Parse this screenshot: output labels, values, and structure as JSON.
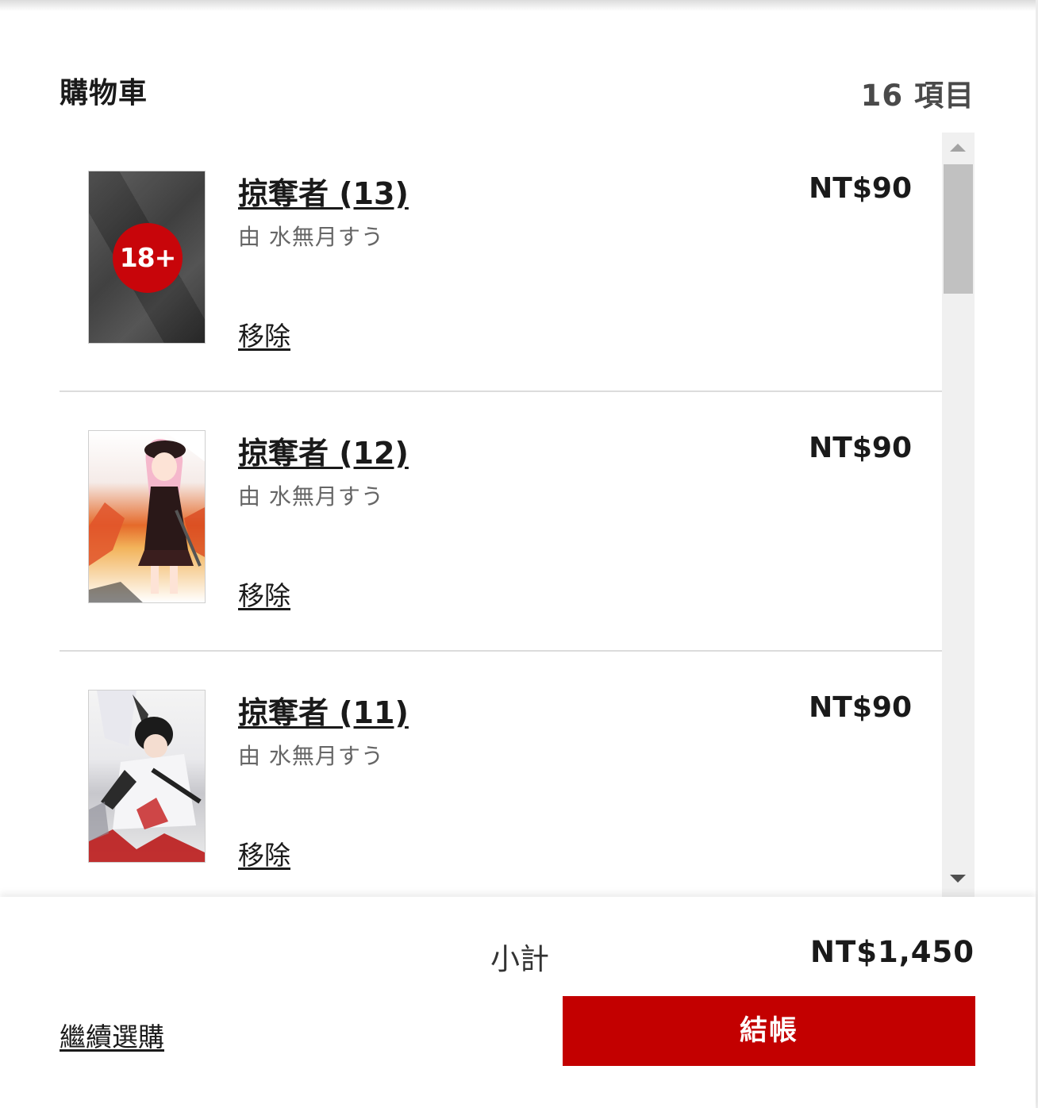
{
  "cart": {
    "title": "購物車",
    "item_count": "16 項目"
  },
  "items": [
    {
      "title": "掠奪者 (13)",
      "author": "由 水無月すう",
      "price": "NT$90",
      "remove_label": "移除",
      "cover_badge": "18+"
    },
    {
      "title": "掠奪者 (12)",
      "author": "由 水無月すう",
      "price": "NT$90",
      "remove_label": "移除"
    },
    {
      "title": "掠奪者 (11)",
      "author": "由 水無月すう",
      "price": "NT$90",
      "remove_label": "移除"
    }
  ],
  "footer": {
    "subtotal_label": "小計",
    "subtotal_value": "NT$1,450",
    "continue_label": "繼續選購",
    "checkout_label": "結帳"
  },
  "colors": {
    "accent": "#c30000",
    "badge": "#c8050a"
  },
  "icons": {
    "scroll_up": "triangle-up-icon",
    "scroll_down": "triangle-down-icon"
  }
}
